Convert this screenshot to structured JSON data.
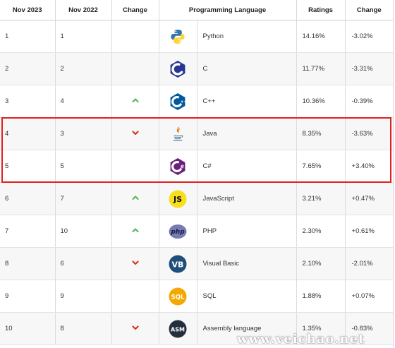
{
  "headers": [
    "Nov 2023",
    "Nov 2022",
    "Change",
    "Programming Language",
    "Ratings",
    "Change"
  ],
  "rows": [
    {
      "rank_2023": "1",
      "rank_2022": "1",
      "trend": "none",
      "language": "Python",
      "icon": "python-icon",
      "rating": "14.16%",
      "change": "-3.02%"
    },
    {
      "rank_2023": "2",
      "rank_2022": "2",
      "trend": "none",
      "language": "C",
      "icon": "c-icon",
      "rating": "11.77%",
      "change": "-3.31%"
    },
    {
      "rank_2023": "3",
      "rank_2022": "4",
      "trend": "up",
      "language": "C++",
      "icon": "cpp-icon",
      "rating": "10.36%",
      "change": "-0.39%"
    },
    {
      "rank_2023": "4",
      "rank_2022": "3",
      "trend": "down",
      "language": "Java",
      "icon": "java-icon",
      "rating": "8.35%",
      "change": "-3.63%"
    },
    {
      "rank_2023": "5",
      "rank_2022": "5",
      "trend": "none",
      "language": "C#",
      "icon": "csharp-icon",
      "rating": "7.65%",
      "change": "+3.40%"
    },
    {
      "rank_2023": "6",
      "rank_2022": "7",
      "trend": "up",
      "language": "JavaScript",
      "icon": "javascript-icon",
      "rating": "3.21%",
      "change": "+0.47%"
    },
    {
      "rank_2023": "7",
      "rank_2022": "10",
      "trend": "up",
      "language": "PHP",
      "icon": "php-icon",
      "rating": "2.30%",
      "change": "+0.61%"
    },
    {
      "rank_2023": "8",
      "rank_2022": "6",
      "trend": "down",
      "language": "Visual Basic",
      "icon": "visual-basic-icon",
      "rating": "2.10%",
      "change": "-2.01%"
    },
    {
      "rank_2023": "9",
      "rank_2022": "9",
      "trend": "none",
      "language": "SQL",
      "icon": "sql-icon",
      "rating": "1.88%",
      "change": "+0.07%"
    },
    {
      "rank_2023": "10",
      "rank_2022": "8",
      "trend": "down",
      "language": "Assembly language",
      "icon": "assembly-icon",
      "rating": "1.35%",
      "change": "-0.83%"
    }
  ],
  "highlighted_rows": [
    "Java",
    "C#"
  ],
  "watermark": "www.veichao.net",
  "colors": {
    "up": "#5cb85c",
    "down": "#d9361f",
    "highlight": "#e02020"
  }
}
